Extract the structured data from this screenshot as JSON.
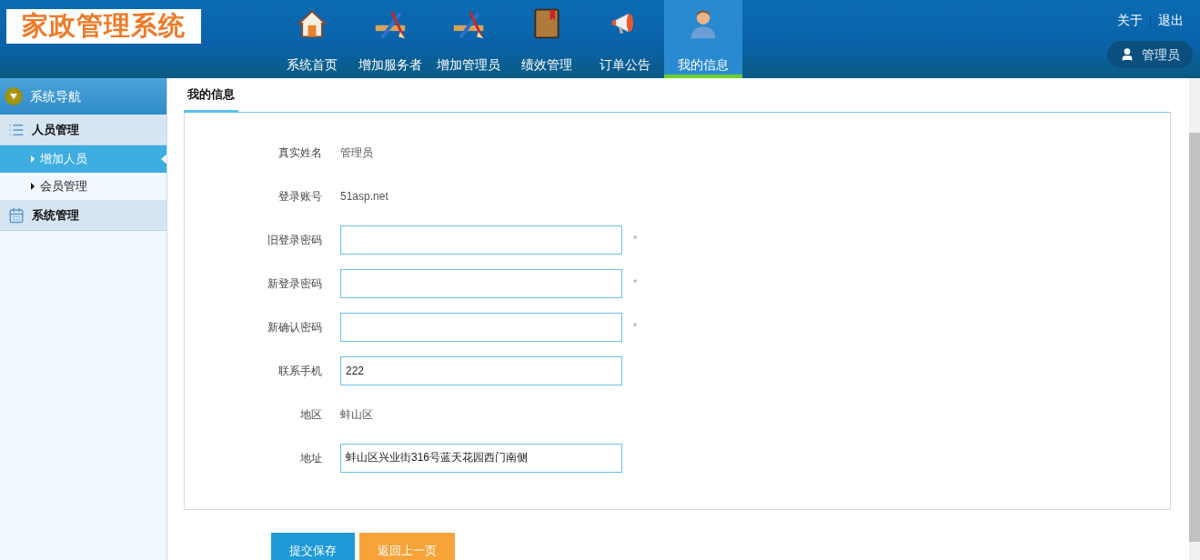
{
  "header": {
    "logo": "家政管理系统",
    "nav": [
      {
        "label": "系统首页",
        "kind": "house",
        "selected": false
      },
      {
        "label": "增加服务者",
        "kind": "pencil",
        "selected": false
      },
      {
        "label": "增加管理员",
        "kind": "pencil",
        "selected": false
      },
      {
        "label": "绩效管理",
        "kind": "book",
        "selected": false
      },
      {
        "label": "订单公告",
        "kind": "megaphone",
        "selected": false
      },
      {
        "label": "我的信息",
        "kind": "user",
        "selected": true
      }
    ],
    "links": [
      "关于",
      "退出"
    ],
    "user": "管理员"
  },
  "sidebar": {
    "title": "系统导航",
    "groups": [
      {
        "label": "人员管理",
        "kind": "list",
        "children": [
          {
            "label": "增加人员",
            "selected": true
          },
          {
            "label": "会员管理",
            "selected": false
          }
        ]
      },
      {
        "label": "系统管理",
        "kind": "calendar"
      }
    ]
  },
  "content": {
    "tab": "我的信息",
    "fields": [
      {
        "label": "真实姓名",
        "kind": "text",
        "value": "管理员"
      },
      {
        "label": "登录账号",
        "kind": "text",
        "value": "51asp.net"
      },
      {
        "label": "旧登录密码",
        "kind": "input",
        "mark": "*"
      },
      {
        "label": "新登录密码",
        "kind": "input",
        "mark": "*"
      },
      {
        "label": "新确认密码",
        "kind": "input",
        "mark": "*"
      },
      {
        "label": "联系手机",
        "kind": "input",
        "value": "222"
      },
      {
        "label": "地区",
        "kind": "text",
        "value": "蚌山区"
      },
      {
        "label": "地址",
        "kind": "input",
        "value": "蚌山区兴业街316号蓝天花园西门南侧"
      }
    ],
    "buttons": [
      {
        "label": "提交保存",
        "kind": "primary"
      },
      {
        "label": "返回上一页",
        "kind": "secondary"
      }
    ]
  }
}
